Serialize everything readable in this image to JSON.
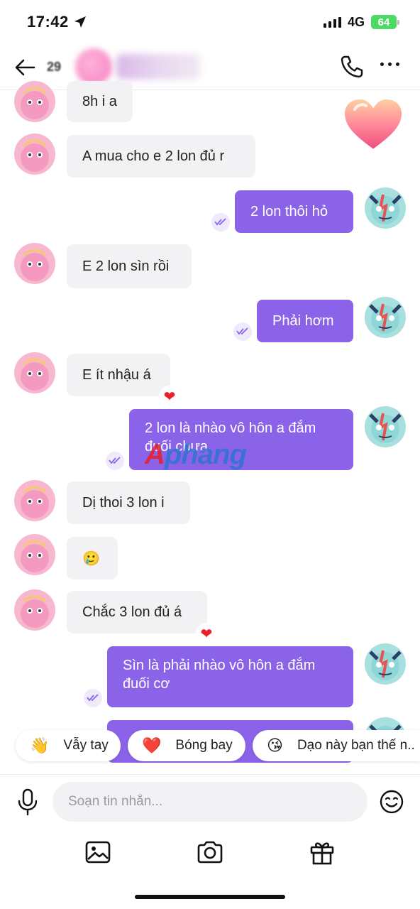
{
  "status_bar": {
    "time": "17:42",
    "network": "4G",
    "battery": "64"
  },
  "header": {
    "count": "29"
  },
  "messages": [
    {
      "side": "left",
      "text": "8h i a"
    },
    {
      "side": "left",
      "text": "A mua cho e 2 lon đủ r"
    },
    {
      "side": "right",
      "text": "2 lon thôi hỏ"
    },
    {
      "side": "left",
      "text": "E 2 lon sìn rồi"
    },
    {
      "side": "right",
      "text": "Phải hơm"
    },
    {
      "side": "left",
      "text": "E ít nhậu á",
      "reaction": "❤"
    },
    {
      "side": "right",
      "text": "2 lon là nhào vô hôn a đắm đuối chưa"
    },
    {
      "side": "left",
      "text": "Dị thoi 3 lon i"
    },
    {
      "side": "left",
      "text": "🥲"
    },
    {
      "side": "left",
      "text": "Chắc 3 lon đủ á",
      "reaction": "❤"
    },
    {
      "side": "right",
      "text": "Sìn là phải nhào vô hôn a đắm đuối cơ"
    }
  ],
  "watermark": {
    "part1": "A",
    "part2": "phang"
  },
  "quick_replies": [
    {
      "emoji": "👋",
      "label": "Vẫy tay"
    },
    {
      "emoji": "❤️",
      "label": "Bóng bay"
    },
    {
      "emoji": "😘",
      "label": "Dạo này bạn thế n.."
    }
  ],
  "composer": {
    "placeholder": "Soạn tin nhắn..."
  },
  "icons": {
    "back": "arrow-left-icon",
    "call": "phone-icon",
    "more": "more-dots-icon",
    "mic": "microphone-icon",
    "emoji": "smiley-icon",
    "image": "image-icon",
    "camera": "camera-icon",
    "gift": "gift-icon",
    "seen": "seen-check-icon"
  },
  "colors": {
    "accent": "#8b63e8",
    "incoming_bubble": "#f2f2f5",
    "reaction": "#e8202a"
  }
}
